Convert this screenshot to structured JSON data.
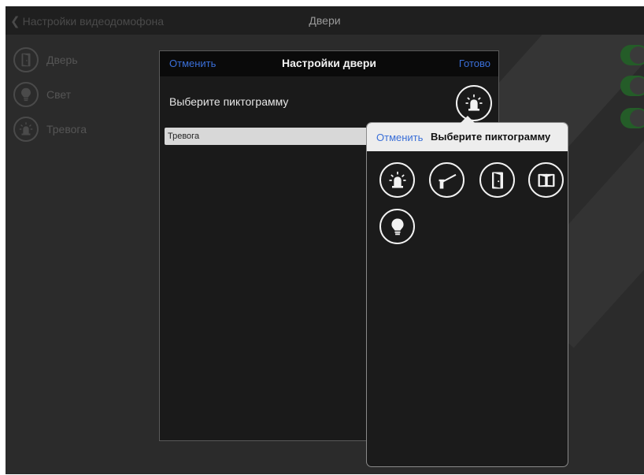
{
  "navbar": {
    "back_label": "Настройки видеодомофона",
    "title": "Двери"
  },
  "sidebar": {
    "items": [
      {
        "label": "Дверь",
        "icon": "door-icon"
      },
      {
        "label": "Свет",
        "icon": "lightbulb-icon"
      },
      {
        "label": "Тревога",
        "icon": "siren-icon"
      }
    ]
  },
  "toggles": [
    {
      "state": "on"
    },
    {
      "state": "on"
    },
    {
      "state": "on"
    }
  ],
  "sheet": {
    "cancel_label": "Отменить",
    "title": "Настройки двери",
    "done_label": "Готово",
    "icon_row_label": "Выберите пиктограмму",
    "selected_icon": "siren-icon",
    "name_value": "Тревога"
  },
  "popover": {
    "cancel_label": "Отменить",
    "title": "Выберите пиктограмму",
    "icons": [
      "siren-icon",
      "barrier-icon",
      "door-icon",
      "double-door-icon",
      "lightbulb-icon"
    ]
  },
  "colors": {
    "accent": "#3a6fd8",
    "toggle_on": "#245c28",
    "background": "#2b2b2b"
  }
}
